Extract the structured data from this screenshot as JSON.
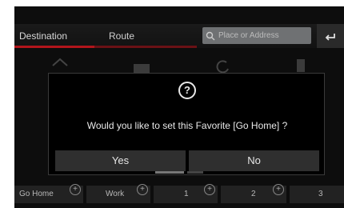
{
  "header": {
    "tab_destination": "Destination",
    "tab_route": "Route",
    "search_placeholder": "Place or Address",
    "back_icon": "back-arrow-icon"
  },
  "dialog": {
    "icon": "question-icon",
    "icon_glyph": "?",
    "message": "Would you like to set this Favorite [Go Home] ?",
    "yes_label": "Yes",
    "no_label": "No"
  },
  "favorites": [
    {
      "label": "Go Home"
    },
    {
      "label": "Work"
    },
    {
      "label": "1"
    },
    {
      "label": "2"
    },
    {
      "label": "3"
    }
  ],
  "colors": {
    "accent": "#b2151b",
    "background": "#0d0d0d"
  }
}
